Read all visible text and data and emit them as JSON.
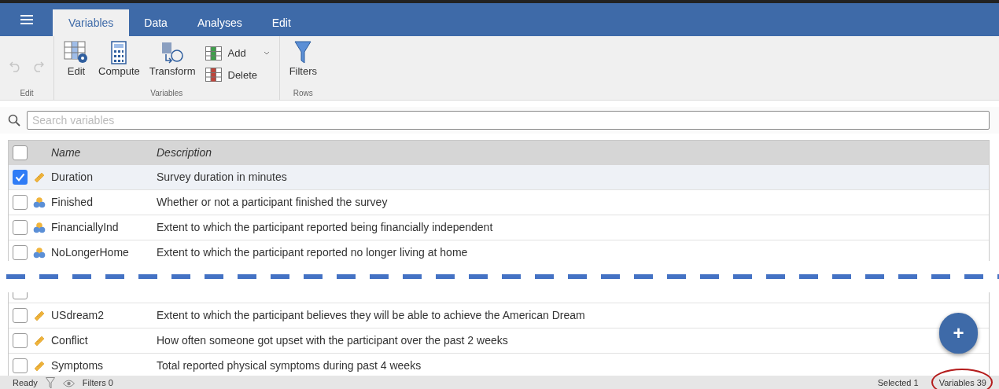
{
  "tabs": [
    {
      "label": "Variables",
      "selected": true
    },
    {
      "label": "Data",
      "selected": false
    },
    {
      "label": "Analyses",
      "selected": false
    },
    {
      "label": "Edit",
      "selected": false
    }
  ],
  "ribbon": {
    "groups": [
      {
        "label": "Edit",
        "items": [
          {
            "kind": "undo",
            "disabled": true
          },
          {
            "kind": "redo",
            "disabled": true
          }
        ]
      },
      {
        "label": "Variables",
        "items": [
          {
            "kind": "edit",
            "label": "Edit"
          },
          {
            "kind": "compute",
            "label": "Compute"
          },
          {
            "kind": "transform",
            "label": "Transform"
          },
          {
            "kind": "add",
            "label": "Add"
          },
          {
            "kind": "delete",
            "label": "Delete"
          }
        ]
      },
      {
        "label": "Rows",
        "items": [
          {
            "kind": "filters",
            "label": "Filters"
          }
        ]
      }
    ]
  },
  "search": {
    "placeholder": "Search variables"
  },
  "table": {
    "header_checked": false,
    "columns": [
      "Name",
      "Description"
    ],
    "rows": [
      {
        "kind": "continuous",
        "name": "Duration",
        "description": "Survey duration in minutes",
        "checked": true
      },
      {
        "kind": "nominal",
        "name": "Finished",
        "description": "Whether or not a participant finished the survey",
        "checked": false
      },
      {
        "kind": "nominal",
        "name": "FinanciallyInd",
        "description": "Extent to which the participant reported being financially independent",
        "checked": false
      },
      {
        "kind": "nominal",
        "name": "NoLongerHome",
        "description": "Extent to which the participant reported no longer living at home",
        "checked": false
      }
    ],
    "cut_row_checked": false,
    "rows_after_break": [
      {
        "kind": "continuous",
        "name": "USdream2",
        "description": "Extent to which the participant believes they will be able to achieve the American Dream",
        "checked": false
      },
      {
        "kind": "continuous",
        "name": "Conflict",
        "description": "How often someone got upset with the participant over the past 2 weeks",
        "checked": false
      },
      {
        "kind": "continuous",
        "name": "Symptoms",
        "description": "Total reported physical symptoms during past 4 weeks",
        "checked": false
      }
    ]
  },
  "add_button": {
    "label": "+"
  },
  "status_bar": {
    "state": "Ready",
    "filters": "Filters 0",
    "selected": "Selected 1",
    "variables": {
      "text": "Variables 39",
      "circled": true
    }
  }
}
